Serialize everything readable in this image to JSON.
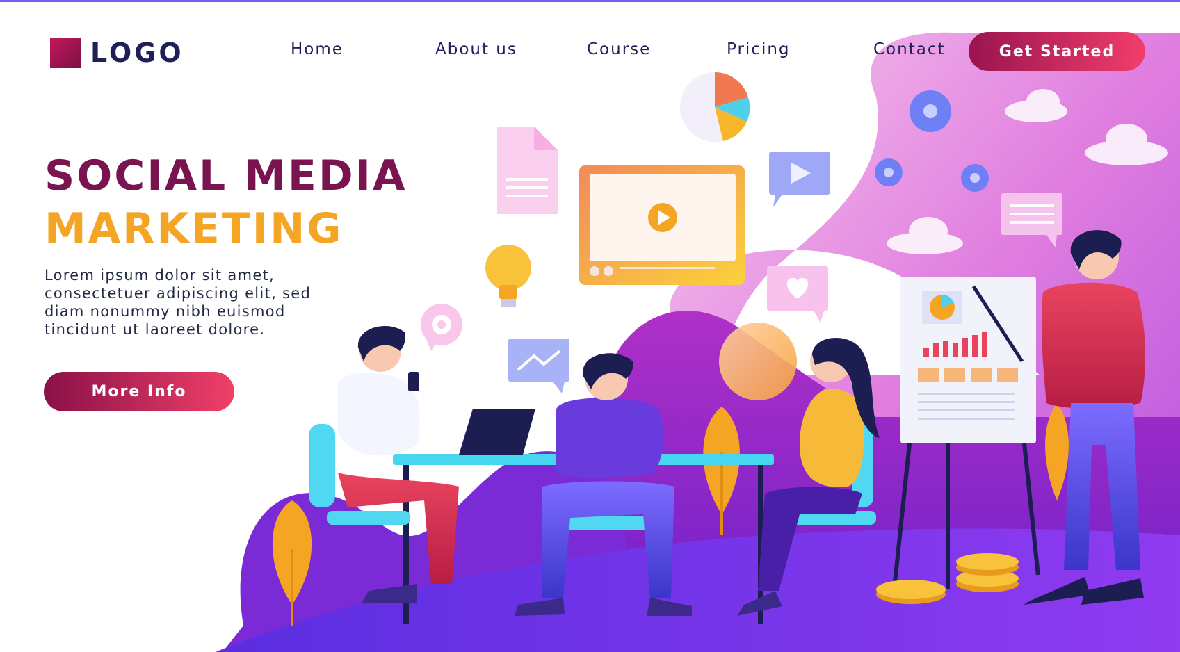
{
  "brand": {
    "logo_text": "LOGO"
  },
  "nav": {
    "items": [
      {
        "label": "Home"
      },
      {
        "label": "About us"
      },
      {
        "label": "Course"
      },
      {
        "label": "Pricing"
      },
      {
        "label": "Contact"
      }
    ],
    "cta_label": "Get Started"
  },
  "hero": {
    "title_line1": "SOCIAL MEDIA",
    "title_line2": "MARKETING",
    "body": "Lorem ipsum dolor sit amet, consectetuer adipiscing elit, sed diam nonummy nibh euismod tincidunt ut laoreet dolore.",
    "button_label": "More Info"
  },
  "colors": {
    "accent_crimson": "#7a1450",
    "accent_orange": "#f5a524",
    "navy_text": "#1e2057",
    "button_gradient_start": "#8a1048",
    "button_gradient_end": "#f04068"
  },
  "illustration": {
    "icons": [
      "pie-chart-icon",
      "document-icon",
      "video-player-icon",
      "play-bubble-icon",
      "gear-icon",
      "lightbulb-icon",
      "settings-bubble-icon",
      "trend-chart-bubble-icon",
      "heart-bubble-icon",
      "message-bubble-icon",
      "cloud-icon",
      "coin-icon",
      "leaf-plant-icon"
    ]
  }
}
